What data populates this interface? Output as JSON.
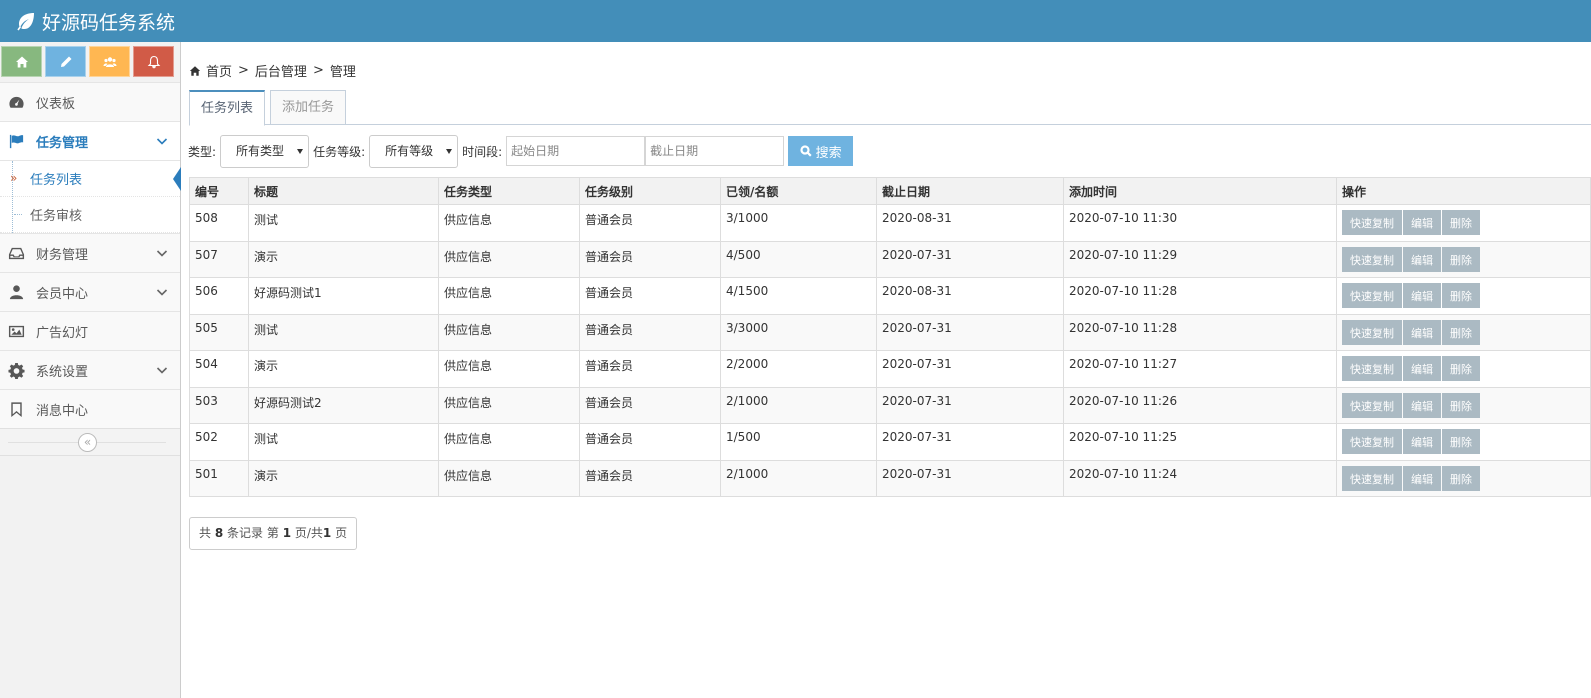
{
  "app": {
    "title": "好源码任务系统"
  },
  "shortcuts": [
    "home-icon",
    "pencil-icon",
    "users-icon",
    "bell-icon"
  ],
  "sidebar": {
    "items": [
      {
        "label": "仪表板",
        "icon": "dashboard-icon"
      },
      {
        "label": "任务管理",
        "icon": "flag-icon",
        "active": true
      },
      {
        "label": "财务管理",
        "icon": "inbox-icon"
      },
      {
        "label": "会员中心",
        "icon": "user-icon"
      },
      {
        "label": "广告幻灯",
        "icon": "picture-icon"
      },
      {
        "label": "系统设置",
        "icon": "gear-icon"
      },
      {
        "label": "消息中心",
        "icon": "bookmark-icon"
      }
    ],
    "submenu": [
      {
        "label": "任务列表",
        "active": true
      },
      {
        "label": "任务审核"
      }
    ],
    "collapse_glyph": "«"
  },
  "breadcrumb": {
    "home": "首页",
    "sep": ">",
    "level2": "后台管理",
    "level3": "管理"
  },
  "tabs": [
    {
      "label": "任务列表"
    },
    {
      "label": "添加任务"
    }
  ],
  "filters": {
    "type_label": "类型:",
    "type_value": "所有类型",
    "level_label": "任务等级:",
    "level_value": "所有等级",
    "period_label": "时间段:",
    "start_placeholder": "起始日期",
    "end_placeholder": "截止日期",
    "search_label": "搜索"
  },
  "table": {
    "headers": [
      "编号",
      "标题",
      "任务类型",
      "任务级别",
      "已领/名额",
      "截止日期",
      "添加时间",
      "操作"
    ],
    "rows": [
      {
        "id": "508",
        "title": "测试",
        "type": "供应信息",
        "level": "普通会员",
        "quota": "3/1000",
        "deadline": "2020-08-31",
        "added": "2020-07-10 11:30"
      },
      {
        "id": "507",
        "title": "演示",
        "type": "供应信息",
        "level": "普通会员",
        "quota": "4/500",
        "deadline": "2020-07-31",
        "added": "2020-07-10 11:29"
      },
      {
        "id": "506",
        "title": "好源码测试1",
        "type": "供应信息",
        "level": "普通会员",
        "quota": "4/1500",
        "deadline": "2020-08-31",
        "added": "2020-07-10 11:28"
      },
      {
        "id": "505",
        "title": "测试",
        "type": "供应信息",
        "level": "普通会员",
        "quota": "3/3000",
        "deadline": "2020-07-31",
        "added": "2020-07-10 11:28"
      },
      {
        "id": "504",
        "title": "演示",
        "type": "供应信息",
        "level": "普通会员",
        "quota": "2/2000",
        "deadline": "2020-07-31",
        "added": "2020-07-10 11:27"
      },
      {
        "id": "503",
        "title": "好源码测试2",
        "type": "供应信息",
        "level": "普通会员",
        "quota": "2/1000",
        "deadline": "2020-07-31",
        "added": "2020-07-10 11:26"
      },
      {
        "id": "502",
        "title": "测试",
        "type": "供应信息",
        "level": "普通会员",
        "quota": "1/500",
        "deadline": "2020-07-31",
        "added": "2020-07-10 11:25"
      },
      {
        "id": "501",
        "title": "演示",
        "type": "供应信息",
        "level": "普通会员",
        "quota": "2/1000",
        "deadline": "2020-07-31",
        "added": "2020-07-10 11:24"
      }
    ],
    "actions": {
      "copy": "快速复制",
      "edit": "编辑",
      "delete": "删除"
    }
  },
  "pager": {
    "prefix": "共",
    "total": "8",
    "mid1": "条记录 第",
    "page": "1",
    "mid2": "页/共",
    "pages": "1",
    "suffix": "页"
  },
  "colors": {
    "navbar": "#438eb9",
    "accent": "#2b7dbc",
    "action_button": "#abbac3",
    "search_button": "#6fb3e0"
  }
}
